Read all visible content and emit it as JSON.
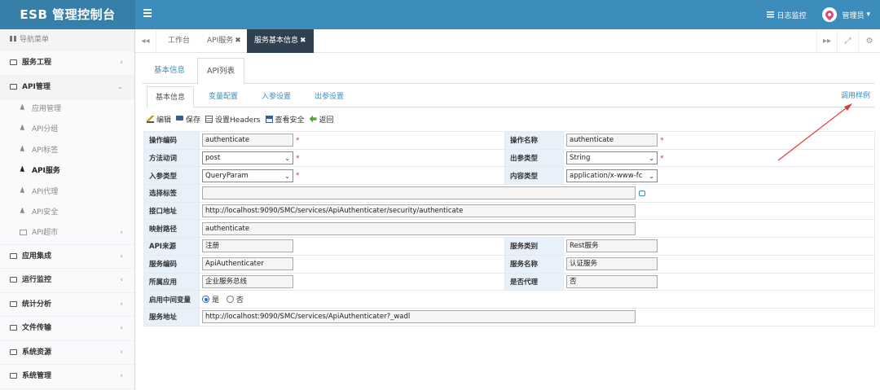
{
  "app": {
    "title": "ESB 管理控制台"
  },
  "header": {
    "monitor_label": "日志监控",
    "user_label": "管理员",
    "user_caret": "▾"
  },
  "sidebar": {
    "nav_header": "导航菜单",
    "items": [
      {
        "label": "服务工程",
        "arrow": "‹"
      },
      {
        "label": "API管理",
        "arrow": "⌄",
        "children": [
          {
            "label": "应用管理"
          },
          {
            "label": "API分组"
          },
          {
            "label": "API标签"
          },
          {
            "label": "API服务"
          },
          {
            "label": "API代理"
          },
          {
            "label": "API安全"
          },
          {
            "label": "API超市",
            "arrow": "‹"
          }
        ]
      },
      {
        "label": "应用集成",
        "arrow": "‹"
      },
      {
        "label": "运行监控",
        "arrow": "‹"
      },
      {
        "label": "统计分析",
        "arrow": "‹"
      },
      {
        "label": "文件传输",
        "arrow": "‹"
      },
      {
        "label": "系统资源",
        "arrow": "‹"
      },
      {
        "label": "系统管理",
        "arrow": "‹"
      }
    ]
  },
  "tabbar": {
    "back": "◂◂",
    "tabs": [
      {
        "label": "工作台",
        "close": ""
      },
      {
        "label": "API服务",
        "close": "✖"
      },
      {
        "label": "服务基本信息",
        "close": "✖"
      }
    ],
    "forward": "▸▸",
    "fullscreen": "⤢",
    "settings": "⚙"
  },
  "subtabs": [
    "基本信息",
    "API列表"
  ],
  "inner_tabs": [
    "基本信息",
    "变量配置",
    "入参设置",
    "出参设置"
  ],
  "sample_link": "调用样例",
  "toolbar": {
    "edit": "编辑",
    "save": "保存",
    "headers": "设置Headers",
    "security": "查看安全",
    "back": "返回"
  },
  "form": {
    "op_code_label": "操作编码",
    "op_code": "authenticate",
    "req": "*",
    "op_name_label": "操作名称",
    "op_name": "authenticate",
    "method_label": "方法动词",
    "method": "post",
    "out_type_label": "出参类型",
    "out_type": "String",
    "in_type_label": "入参类型",
    "in_type": "QueryParam",
    "content_type_label": "内容类型",
    "content_type": "application/x-www-fc",
    "tag_label": "选择标签",
    "tag_value": "",
    "endpoint_label": "接口地址",
    "endpoint": "http://localhost:9090/SMC/services/ApiAuthenticater/security/authenticate",
    "mapping_label": "映射路径",
    "mapping": "authenticate",
    "source_label": "API来源",
    "source": "注册",
    "service_type_label": "服务类别",
    "service_type": "Rest服务",
    "service_code_label": "服务编码",
    "service_code": "ApiAuthenticater",
    "service_name_label": "服务名称",
    "service_name": "认证服务",
    "app_label": "所属应用",
    "app": "企业服务总线",
    "proxy_label": "是否代理",
    "proxy": "否",
    "middleware_label": "启用中间变量",
    "yes": "是",
    "no": "否",
    "middleware_value": "是",
    "service_addr_label": "服务地址",
    "service_addr": "http://localhost:9090/SMC/services/ApiAuthenticater?_wadl"
  },
  "colors": {
    "header": "#3c8dbc",
    "logo_bg": "#367fa9",
    "active_tab": "#2f4050",
    "label_bg": "#e8f0fa",
    "annotation": "#e03a3a"
  }
}
